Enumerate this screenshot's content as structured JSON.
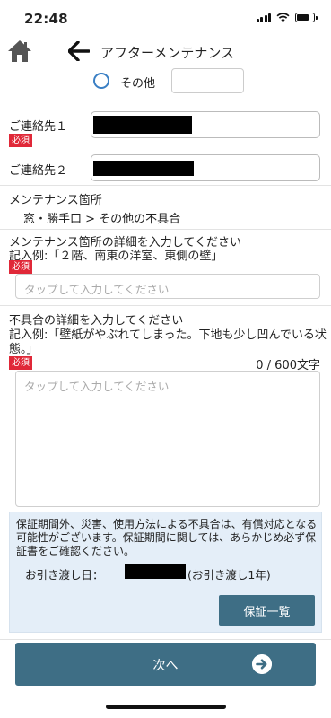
{
  "status_bar": {
    "time": "22:48"
  },
  "nav": {
    "title": "アフターメンテナンス"
  },
  "radio_option": {
    "label": "その他"
  },
  "contact1": {
    "label": "ご連絡先１",
    "required": "必須"
  },
  "contact2": {
    "label": "ご連絡先２"
  },
  "maintenance_location": {
    "label": "メンテナンス箇所",
    "value": "窓・勝手口 > その他の不具合"
  },
  "location_detail": {
    "label": "メンテナンス箇所の詳細を入力してください",
    "example": "記入例:「２階、南東の洋室、東側の壁」",
    "required": "必須",
    "placeholder": "タップして入力してください"
  },
  "defect_detail": {
    "label": "不具合の詳細を入力してください",
    "example_line1": "記入例:「壁紙がやぶれてしまった。下地も少し凹んでいる状",
    "example_line2": "態。」",
    "required": "必須",
    "counter": "0 / 600文字",
    "placeholder": "タップして入力してください"
  },
  "warranty_info": {
    "text": "保証期間外、災害、使用方法による不具合は、有償対応となる可能性がございます。保証期間に関しては、あらかじめ必ず保証書をご確認ください。",
    "delivery_label": "お引き渡し日：",
    "delivery_note": "(お引き渡し1年)",
    "button_label": "保証一覧"
  },
  "next_button": {
    "label": "次へ"
  },
  "colors": {
    "primary": "#3e6e85",
    "required": "#e02838",
    "info_bg": "#e4eef8",
    "radio": "#3a7fc4"
  }
}
